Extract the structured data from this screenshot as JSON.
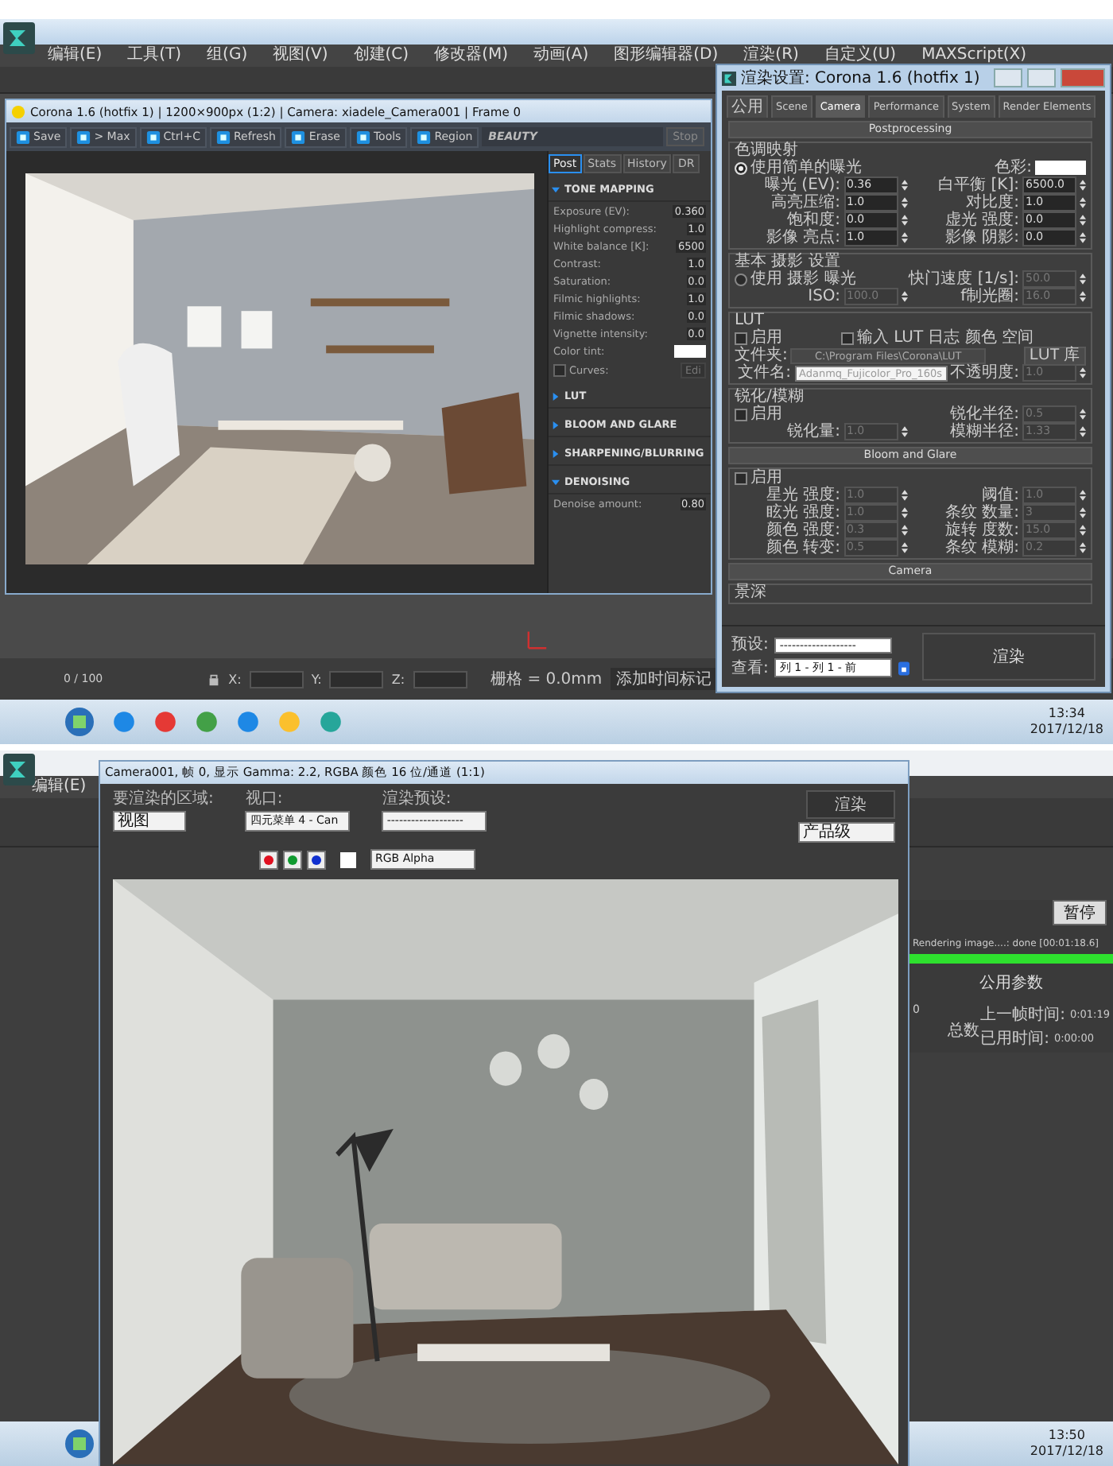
{
  "top": {
    "menu": [
      "编辑(E)",
      "工具(T)",
      "组(G)",
      "视图(V)",
      "创建(C)",
      "修改器(M)",
      "动画(A)",
      "图形编辑器(D)",
      "渲染(R)",
      "自定义(U)",
      "MAXScript(X)"
    ],
    "vfb": {
      "title": "Corona 1.6 (hotfix 1) | 1200×900px (1:2) | Camera: xiadele_Camera001 | Frame 0",
      "toolbar": [
        "Save",
        "> Max",
        "Ctrl+C",
        "Refresh",
        "Erase",
        "Tools",
        "Region"
      ],
      "channel": "BEAUTY",
      "stop": "Stop",
      "tabs": [
        {
          "label": "Post",
          "selected": true
        },
        {
          "label": "Stats",
          "selected": false
        },
        {
          "label": "History",
          "selected": false
        },
        {
          "label": "DR",
          "selected": false
        }
      ],
      "sections": [
        {
          "title": "TONE MAPPING",
          "expanded": true,
          "params": [
            {
              "kind": "number",
              "label": "Exposure (EV):",
              "value": "0.360"
            },
            {
              "kind": "number",
              "label": "Highlight compress:",
              "value": "1.0"
            },
            {
              "kind": "number",
              "label": "White balance [K]:",
              "value": "6500"
            },
            {
              "kind": "number",
              "label": "Contrast:",
              "value": "1.0"
            },
            {
              "kind": "number",
              "label": "Saturation:",
              "value": "0.0"
            },
            {
              "kind": "number",
              "label": "Filmic highlights:",
              "value": "1.0"
            },
            {
              "kind": "number",
              "label": "Filmic shadows:",
              "value": "0.0"
            },
            {
              "kind": "number",
              "label": "Vignette intensity:",
              "value": "0.0"
            },
            {
              "kind": "color",
              "label": "Color tint:"
            },
            {
              "kind": "check",
              "label": "Curves:",
              "checked": false,
              "button": "Edi"
            }
          ]
        },
        {
          "title": "LUT",
          "expanded": false
        },
        {
          "title": "BLOOM AND GLARE",
          "expanded": false
        },
        {
          "title": "SHARPENING/BLURRING",
          "expanded": false
        },
        {
          "title": "DENOISING",
          "expanded": true,
          "params": [
            {
              "kind": "number",
              "label": "Denoise amount:",
              "value": "0.80"
            }
          ]
        }
      ]
    },
    "render_setup": {
      "title": "渲染设置: Corona 1.6 (hotfix 1)",
      "tabs": [
        {
          "label": "公用",
          "selected": false
        },
        {
          "label": "Scene",
          "selected": false
        },
        {
          "label": "Camera",
          "selected": true
        },
        {
          "label": "Performance",
          "selected": false
        },
        {
          "label": "System",
          "selected": false
        },
        {
          "label": "Render Elements",
          "selected": false
        }
      ],
      "rollouts": [
        {
          "title": "Postprocessing",
          "groups": [
            {
              "title": "色调映射",
              "rows": [
                [
                  {
                    "kind": "radio",
                    "label": "使用简单的曝光",
                    "selected": true
                  },
                  {
                    "kind": "color",
                    "label": "色彩:"
                  }
                ],
                [
                  {
                    "kind": "field",
                    "label": "曝光 (EV):",
                    "value": "0.36",
                    "disabled": false
                  },
                  {
                    "kind": "field",
                    "label": "白平衡 [K]:",
                    "value": "6500.0",
                    "disabled": false
                  }
                ],
                [
                  {
                    "kind": "field",
                    "label": "高亮压缩:",
                    "value": "1.0",
                    "disabled": false
                  },
                  {
                    "kind": "field",
                    "label": "对比度:",
                    "value": "1.0",
                    "disabled": false
                  }
                ],
                [
                  {
                    "kind": "field",
                    "label": "饱和度:",
                    "value": "0.0",
                    "disabled": false
                  },
                  {
                    "kind": "field",
                    "label": "虚光 强度:",
                    "value": "0.0",
                    "disabled": false
                  }
                ],
                [
                  {
                    "kind": "field",
                    "label": "影像 亮点:",
                    "value": "1.0",
                    "disabled": false
                  },
                  {
                    "kind": "field",
                    "label": "影像 阴影:",
                    "value": "0.0",
                    "disabled": false
                  }
                ]
              ]
            },
            {
              "title": "基本 摄影 设置",
              "rows": [
                [
                  {
                    "kind": "radio",
                    "label": "使用 摄影 曝光",
                    "selected": false
                  },
                  {
                    "kind": "field",
                    "label": "快门速度 [1/s]:",
                    "value": "50.0",
                    "disabled": true
                  }
                ],
                [
                  {
                    "kind": "field",
                    "label": "ISO:",
                    "value": "100.0",
                    "disabled": true
                  },
                  {
                    "kind": "field",
                    "label": "f制光圈:",
                    "value": "16.0",
                    "disabled": true
                  }
                ]
              ]
            },
            {
              "title": "LUT",
              "rows": [
                [
                  {
                    "kind": "check",
                    "label": "启用",
                    "checked": false
                  },
                  {
                    "kind": "check",
                    "label": "输入 LUT 日志 颜色 空间",
                    "checked": false
                  }
                ],
                [
                  {
                    "kind": "path",
                    "label": "文件夹:",
                    "value": "C:\\Program Files\\Corona\\LUT"
                  },
                  {
                    "kind": "button",
                    "label": "LUT 库"
                  }
                ],
                [
                  {
                    "kind": "dropdown",
                    "label": "文件名:",
                    "value": "Adanmq_Fujicolor_Pro_160s"
                  },
                  {
                    "kind": "field",
                    "label": "不透明度:",
                    "value": "1.0",
                    "disabled": true
                  }
                ]
              ]
            },
            {
              "title": "锐化/模糊",
              "rows": [
                [
                  {
                    "kind": "check",
                    "label": "启用",
                    "checked": false
                  },
                  {
                    "kind": "field",
                    "label": "锐化半径:",
                    "value": "0.5",
                    "disabled": true
                  }
                ],
                [
                  {
                    "kind": "field",
                    "label": "锐化量:",
                    "value": "1.0",
                    "disabled": true
                  },
                  {
                    "kind": "field",
                    "label": "模糊半径:",
                    "value": "1.33",
                    "disabled": true
                  }
                ]
              ]
            }
          ]
        },
        {
          "title": "Bloom and Glare",
          "groups": [
            {
              "rows": [
                [
                  {
                    "kind": "check",
                    "label": "启用",
                    "checked": false
                  }
                ],
                [
                  {
                    "kind": "field",
                    "label": "星光 强度:",
                    "value": "1.0",
                    "disabled": true
                  },
                  {
                    "kind": "field",
                    "label": "阈值:",
                    "value": "1.0",
                    "disabled": true
                  }
                ],
                [
                  {
                    "kind": "field",
                    "label": "眩光 强度:",
                    "value": "1.0",
                    "disabled": true
                  },
                  {
                    "kind": "field",
                    "label": "条纹 数量:",
                    "value": "3",
                    "disabled": true
                  }
                ],
                [
                  {
                    "kind": "field",
                    "label": "颜色 强度:",
                    "value": "0.3",
                    "disabled": true
                  },
                  {
                    "kind": "field",
                    "label": "旋转 度数:",
                    "value": "15.0",
                    "disabled": true
                  }
                ],
                [
                  {
                    "kind": "field",
                    "label": "颜色 转变:",
                    "value": "0.5",
                    "disabled": true
                  },
                  {
                    "kind": "field",
                    "label": "条纹 模糊:",
                    "value": "0.2",
                    "disabled": true
                  }
                ]
              ]
            }
          ]
        },
        {
          "title": "Camera",
          "groups": [
            {
              "title": "景深"
            }
          ]
        }
      ],
      "preset_label": "预设:",
      "preset": "-------------------",
      "view_label": "查看:",
      "view": "列 1 - 列 1 - 前",
      "render": "渲染"
    },
    "status": {
      "timeline": "0 / 100",
      "coords": [
        "X:",
        "Y:",
        "Z:"
      ],
      "grid": "栅格 = 0.0mm",
      "time_tag": "添加时间标记"
    },
    "taskbar": {
      "time": "13:34",
      "date": "2017/12/18"
    }
  },
  "bottom": {
    "menu": [
      "编辑(E)"
    ],
    "frame_window": {
      "title": "Camera001, 帧 0, 显示 Gamma: 2.2, RGBA 颜色 16 位/通道 (1:1)",
      "area_label": "要渲染的区域:",
      "area": "视图",
      "viewport_label": "视口:",
      "viewport": "四元菜单 4 - Can",
      "preset_label": "渲染预设:",
      "preset": "-------------------",
      "render": "渲染",
      "quality": "产品级",
      "channel": "RGB Alpha",
      "colors": [
        {
          "color": "#e01020"
        },
        {
          "color": "#109a30"
        },
        {
          "color": "#1030d0"
        }
      ]
    },
    "progress": {
      "pause": "暂停",
      "status": "Rendering image....: done [00:01:18.6]",
      "level": 1,
      "section": "公用参数",
      "frame": "0",
      "total": "总数",
      "rows": [
        {
          "label": "上一帧时间:",
          "value": "0:01:19"
        },
        {
          "label": "已用时间:",
          "value": "0:00:00"
        }
      ]
    },
    "taskbar": {
      "time": "13:50",
      "date": "2017/12/18"
    }
  }
}
